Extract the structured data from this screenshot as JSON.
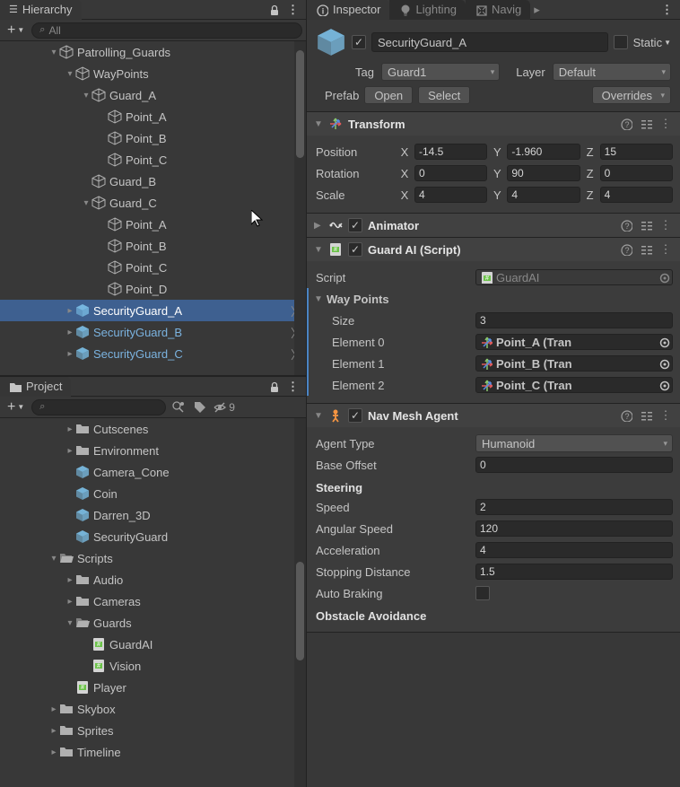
{
  "hierarchy": {
    "tab_label": "Hierarchy",
    "search_placeholder": "All",
    "rows": [
      {
        "indent": 3,
        "foldout": "▾",
        "label": "Patrolling_Guards",
        "icon": "go"
      },
      {
        "indent": 4,
        "foldout": "▾",
        "label": "WayPoints",
        "icon": "go"
      },
      {
        "indent": 5,
        "foldout": "▾",
        "label": "Guard_A",
        "icon": "go"
      },
      {
        "indent": 6,
        "foldout": "",
        "label": "Point_A",
        "icon": "go"
      },
      {
        "indent": 6,
        "foldout": "",
        "label": "Point_B",
        "icon": "go"
      },
      {
        "indent": 6,
        "foldout": "",
        "label": "Point_C",
        "icon": "go"
      },
      {
        "indent": 5,
        "foldout": "",
        "label": "Guard_B",
        "icon": "go"
      },
      {
        "indent": 5,
        "foldout": "▾",
        "label": "Guard_C",
        "icon": "go"
      },
      {
        "indent": 6,
        "foldout": "",
        "label": "Point_A",
        "icon": "go"
      },
      {
        "indent": 6,
        "foldout": "",
        "label": "Point_B",
        "icon": "go"
      },
      {
        "indent": 6,
        "foldout": "",
        "label": "Point_C",
        "icon": "go"
      },
      {
        "indent": 6,
        "foldout": "",
        "label": "Point_D",
        "icon": "go"
      },
      {
        "indent": 4,
        "foldout": "▸",
        "label": "SecurityGuard_A",
        "icon": "prefab",
        "selected": true,
        "prefab": true,
        "chevron": true
      },
      {
        "indent": 4,
        "foldout": "▸",
        "label": "SecurityGuard_B",
        "icon": "prefab",
        "prefab": true,
        "chevron": true
      },
      {
        "indent": 4,
        "foldout": "▸",
        "label": "SecurityGuard_C",
        "icon": "prefab",
        "prefab": true,
        "chevron": true
      }
    ]
  },
  "project": {
    "tab_label": "Project",
    "hidden_count": "9",
    "rows": [
      {
        "indent": 4,
        "foldout": "▸",
        "label": "Cutscenes",
        "icon": "folder"
      },
      {
        "indent": 4,
        "foldout": "▸",
        "label": "Environment",
        "icon": "folder"
      },
      {
        "indent": 4,
        "foldout": "",
        "label": "Camera_Cone",
        "icon": "prefab"
      },
      {
        "indent": 4,
        "foldout": "",
        "label": "Coin",
        "icon": "prefab"
      },
      {
        "indent": 4,
        "foldout": "",
        "label": "Darren_3D",
        "icon": "prefab"
      },
      {
        "indent": 4,
        "foldout": "",
        "label": "SecurityGuard",
        "icon": "prefab"
      },
      {
        "indent": 3,
        "foldout": "▾",
        "label": "Scripts",
        "icon": "folder-open"
      },
      {
        "indent": 4,
        "foldout": "▸",
        "label": "Audio",
        "icon": "folder"
      },
      {
        "indent": 4,
        "foldout": "▸",
        "label": "Cameras",
        "icon": "folder"
      },
      {
        "indent": 4,
        "foldout": "▾",
        "label": "Guards",
        "icon": "folder-open"
      },
      {
        "indent": 5,
        "foldout": "",
        "label": "GuardAI",
        "icon": "script"
      },
      {
        "indent": 5,
        "foldout": "",
        "label": "Vision",
        "icon": "script"
      },
      {
        "indent": 4,
        "foldout": "",
        "label": "Player",
        "icon": "script"
      },
      {
        "indent": 3,
        "foldout": "▸",
        "label": "Skybox",
        "icon": "folder"
      },
      {
        "indent": 3,
        "foldout": "▸",
        "label": "Sprites",
        "icon": "folder"
      },
      {
        "indent": 3,
        "foldout": "▸",
        "label": "Timeline",
        "icon": "folder"
      }
    ]
  },
  "inspector": {
    "tabs": {
      "inspector": "Inspector",
      "lighting": "Lighting",
      "navigation": "Navig"
    },
    "object_name": "SecurityGuard_A",
    "static_label": "Static",
    "tag_label": "Tag",
    "tag_value": "Guard1",
    "layer_label": "Layer",
    "layer_value": "Default",
    "prefab_label": "Prefab",
    "open_btn": "Open",
    "select_btn": "Select",
    "overrides_btn": "Overrides",
    "transform": {
      "title": "Transform",
      "position_label": "Position",
      "rotation_label": "Rotation",
      "scale_label": "Scale",
      "pos": {
        "x": "-14.5",
        "y": "-1.960",
        "z": "15"
      },
      "rot": {
        "x": "0",
        "y": "90",
        "z": "0"
      },
      "scl": {
        "x": "4",
        "y": "4",
        "z": "4"
      }
    },
    "animator": {
      "title": "Animator"
    },
    "guard_ai": {
      "title": "Guard AI (Script)",
      "script_label": "Script",
      "script_value": "GuardAI",
      "waypoints_label": "Way Points",
      "size_label": "Size",
      "size_value": "3",
      "elements": [
        {
          "label": "Element 0",
          "value": "Point_A (Tran"
        },
        {
          "label": "Element 1",
          "value": "Point_B (Tran"
        },
        {
          "label": "Element 2",
          "value": "Point_C (Tran"
        }
      ]
    },
    "navmesh": {
      "title": "Nav Mesh Agent",
      "agent_type_label": "Agent Type",
      "agent_type_value": "Humanoid",
      "base_offset_label": "Base Offset",
      "base_offset_value": "0",
      "steering_label": "Steering",
      "speed_label": "Speed",
      "speed_value": "2",
      "angular_label": "Angular Speed",
      "angular_value": "120",
      "accel_label": "Acceleration",
      "accel_value": "4",
      "stopdist_label": "Stopping Distance",
      "stopdist_value": "1.5",
      "autobrake_label": "Auto Braking",
      "obstacle_label": "Obstacle Avoidance"
    }
  }
}
